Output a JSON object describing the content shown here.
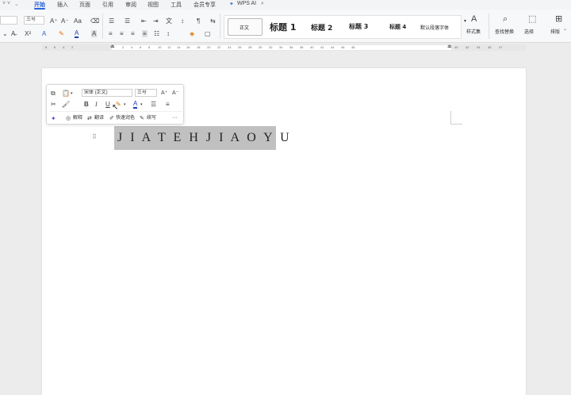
{
  "menu_tabs": [
    "开始",
    "插入",
    "页面",
    "引用",
    "审阅",
    "视图",
    "工具",
    "会员专享"
  ],
  "wps_ai": "WPS AI",
  "ribbon": {
    "font_size_top": "三号",
    "font_grow": "A⁺",
    "font_shrink": "A⁻",
    "change_case": "Aa",
    "superscript": "X²",
    "strike": "A̶",
    "font_color": "A",
    "styles": [
      "正文",
      "标题 1",
      "标题 2",
      "标题 3",
      "标题 4",
      "默认段落字体"
    ],
    "style_set": "样式集",
    "find_replace": "查找替换",
    "select": "选择",
    "typeset": "排版"
  },
  "ruler_numbers": [
    "8",
    "6",
    "4",
    "2",
    "",
    "2",
    "4",
    "6",
    "8",
    "10",
    "12",
    "14",
    "16",
    "18",
    "20",
    "22",
    "24",
    "26",
    "28",
    "30",
    "32",
    "34",
    "36",
    "38",
    "40",
    "42",
    "44",
    "46",
    "48"
  ],
  "ruler_right": [
    "40",
    "42",
    "44",
    "46",
    "47"
  ],
  "mini_toolbar": {
    "font": "宋体 (正文)",
    "size": "三号",
    "bold": "B",
    "italic": "I",
    "underline": "U",
    "explain": "解释",
    "translate": "翻译",
    "quick_polish": "快速润色",
    "continue": "续写",
    "more": "···"
  },
  "document": {
    "text": "J I A T E H J I A O Y U"
  }
}
